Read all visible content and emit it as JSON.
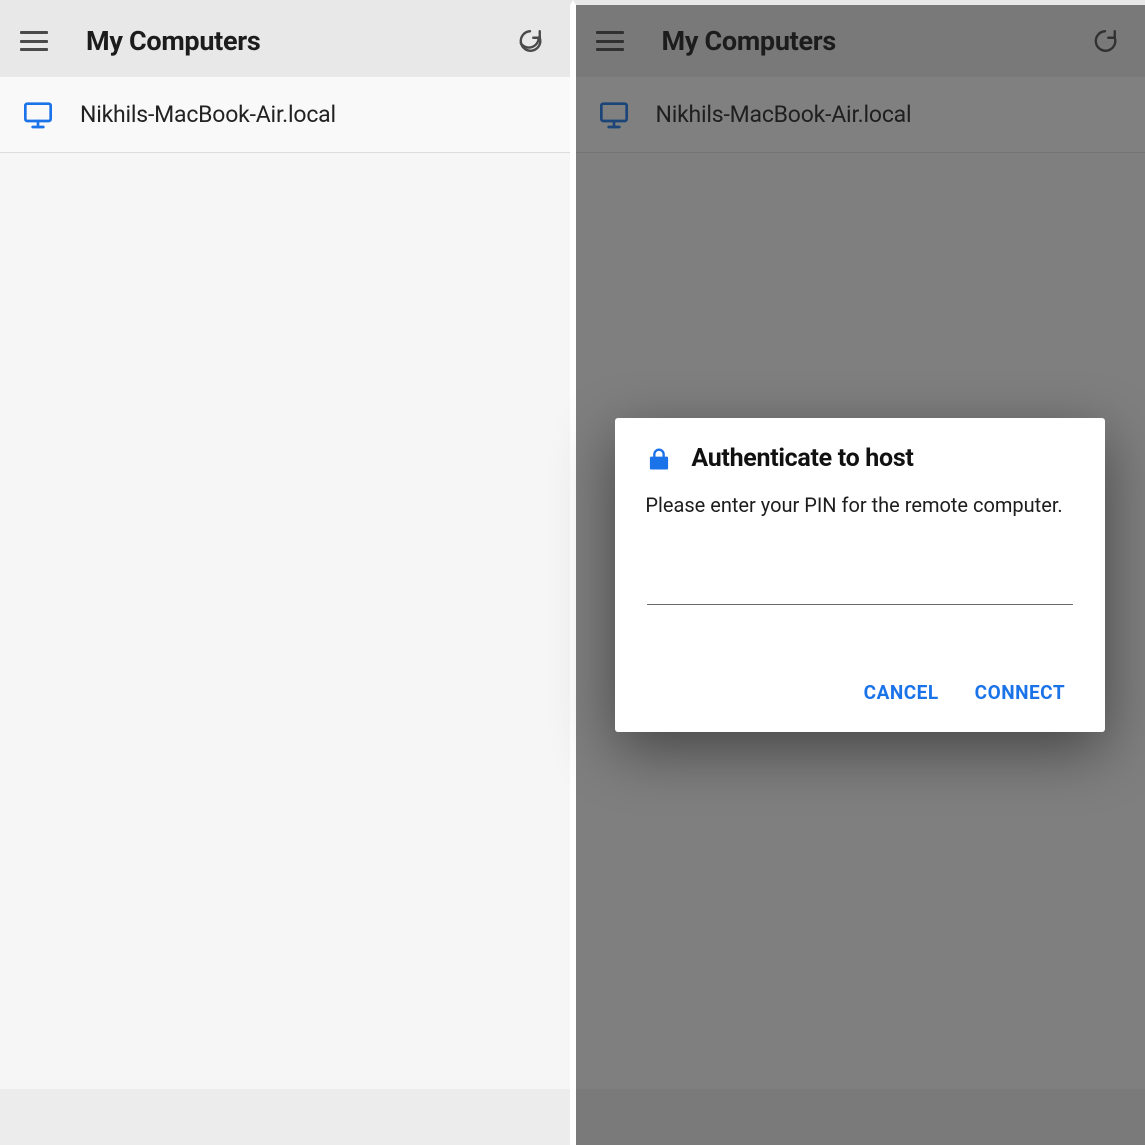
{
  "colors": {
    "accent": "#1a73e8",
    "monitor": "#1a73e8"
  },
  "left": {
    "header": {
      "title": "My Computers"
    },
    "list": {
      "items": [
        {
          "hostname": "Nikhils-MacBook-Air.local"
        }
      ]
    }
  },
  "right": {
    "header": {
      "title": "My Computers"
    },
    "list": {
      "items": [
        {
          "hostname": "Nikhils-MacBook-Air.local"
        }
      ]
    },
    "dialog": {
      "title": "Authenticate to host",
      "message": "Please enter your PIN for the remote computer.",
      "pin_value": "",
      "cancel_label": "CANCEL",
      "connect_label": "CONNECT"
    }
  }
}
